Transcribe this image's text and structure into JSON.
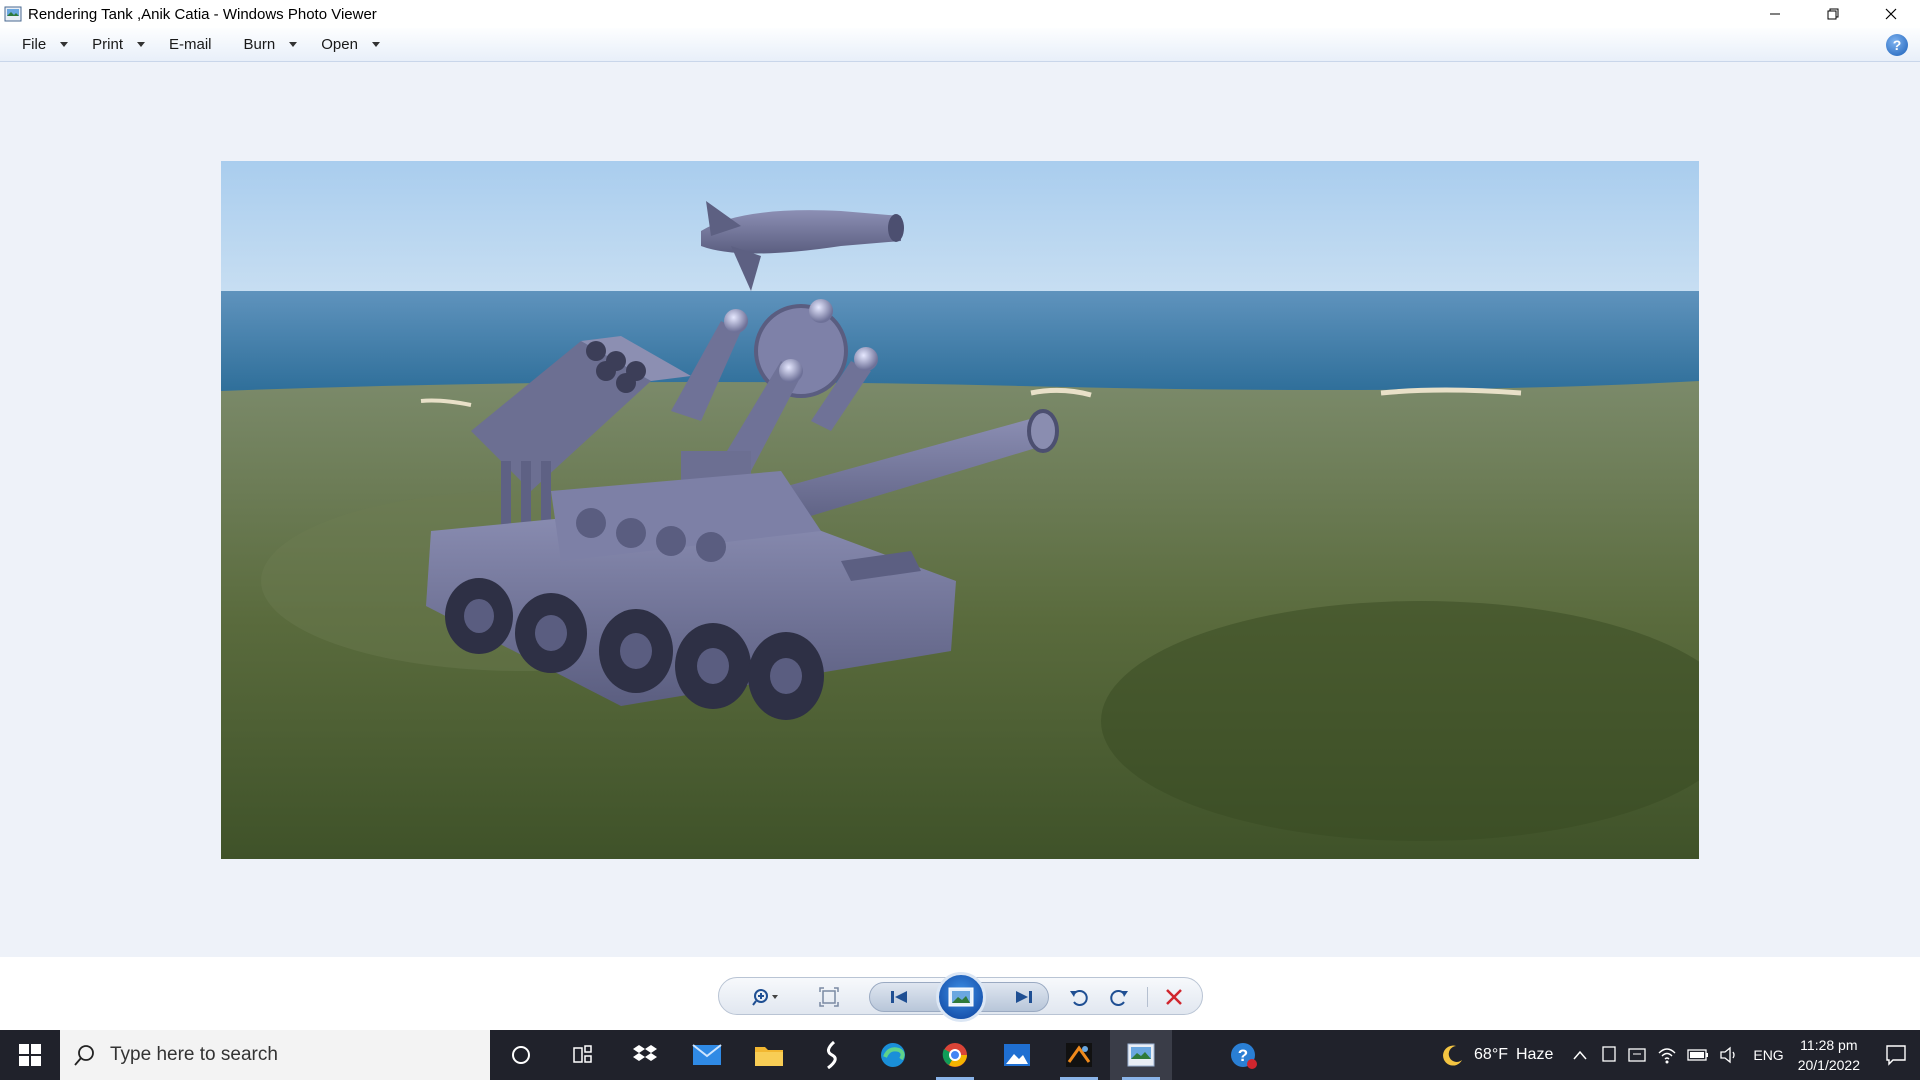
{
  "window": {
    "title": "Rendering Tank ,Anik Catia - Windows Photo Viewer"
  },
  "menu": {
    "items": [
      {
        "label": "File",
        "has_dropdown": true
      },
      {
        "label": "Print",
        "has_dropdown": true
      },
      {
        "label": "E-mail",
        "has_dropdown": false
      },
      {
        "label": "Burn",
        "has_dropdown": true
      },
      {
        "label": "Open",
        "has_dropdown": true
      }
    ],
    "help_label": "?"
  },
  "toolbar": {
    "buttons": [
      "zoom-icon",
      "actual-size-icon",
      "previous-icon",
      "slideshow-icon",
      "next-icon",
      "rotate-left-icon",
      "rotate-right-icon",
      "delete-icon"
    ],
    "delete_color": "#d0262e"
  },
  "taskbar": {
    "search_placeholder": "Type here to search",
    "apps": [
      "cortana-icon",
      "task-view-icon",
      "dropbox-icon",
      "mail-icon",
      "file-explorer-icon",
      "catia-icon",
      "edge-icon",
      "chrome-icon",
      "photos-icon",
      "render-app-icon",
      "photo-viewer-icon",
      "help-app-icon"
    ],
    "weather": {
      "temp": "68°F",
      "condition": "Haze"
    },
    "language": "ENG",
    "time": "11:28 pm",
    "date": "20/1/2022"
  },
  "colors": {
    "taskbar_bg": "#20222b",
    "viewer_bg": "#eef2f9",
    "accent_blue": "#1a5fb8"
  }
}
